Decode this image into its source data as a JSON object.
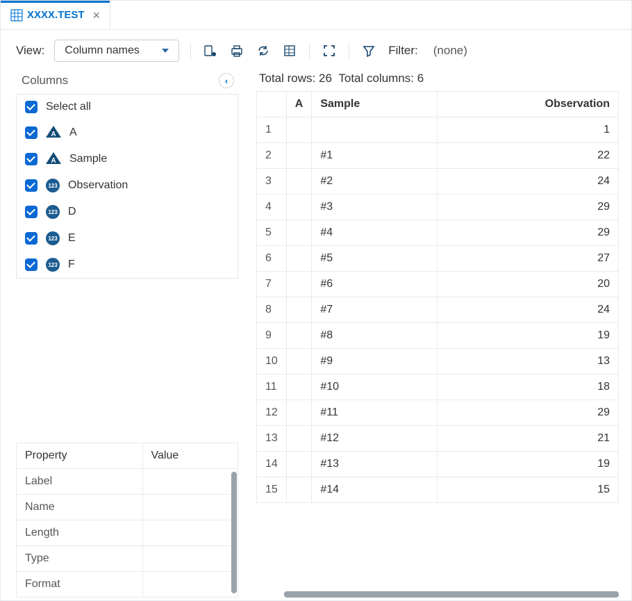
{
  "tab": {
    "title": "XXXX.TEST"
  },
  "toolbar": {
    "view_label": "View:",
    "view_value": "Column names",
    "filter_label": "Filter:",
    "filter_value": "(none)"
  },
  "columns": {
    "panel_title": "Columns",
    "select_all_label": "Select all",
    "items": [
      {
        "name": "A",
        "type": "char"
      },
      {
        "name": "Sample",
        "type": "char"
      },
      {
        "name": "Observation",
        "type": "num"
      },
      {
        "name": "D",
        "type": "num"
      },
      {
        "name": "E",
        "type": "num"
      },
      {
        "name": "F",
        "type": "num"
      }
    ]
  },
  "properties": {
    "header_property": "Property",
    "header_value": "Value",
    "rows": [
      {
        "prop": "Label",
        "val": ""
      },
      {
        "prop": "Name",
        "val": ""
      },
      {
        "prop": "Length",
        "val": ""
      },
      {
        "prop": "Type",
        "val": ""
      },
      {
        "prop": "Format",
        "val": ""
      }
    ]
  },
  "data": {
    "stats": {
      "rows_label": "Total rows:",
      "rows": 26,
      "cols_label": "Total columns:",
      "cols": 6
    },
    "headers": {
      "a": "A",
      "sample": "Sample",
      "obs": "Observation"
    },
    "rows": [
      {
        "n": 1,
        "a": "",
        "sample": "",
        "obs": 1
      },
      {
        "n": 2,
        "a": "",
        "sample": "#1",
        "obs": 22
      },
      {
        "n": 3,
        "a": "",
        "sample": "#2",
        "obs": 24
      },
      {
        "n": 4,
        "a": "",
        "sample": "#3",
        "obs": 29
      },
      {
        "n": 5,
        "a": "",
        "sample": "#4",
        "obs": 29
      },
      {
        "n": 6,
        "a": "",
        "sample": "#5",
        "obs": 27
      },
      {
        "n": 7,
        "a": "",
        "sample": "#6",
        "obs": 20
      },
      {
        "n": 8,
        "a": "",
        "sample": "#7",
        "obs": 24
      },
      {
        "n": 9,
        "a": "",
        "sample": "#8",
        "obs": 19
      },
      {
        "n": 10,
        "a": "",
        "sample": "#9",
        "obs": 13
      },
      {
        "n": 11,
        "a": "",
        "sample": "#10",
        "obs": 18
      },
      {
        "n": 12,
        "a": "",
        "sample": "#11",
        "obs": 29
      },
      {
        "n": 13,
        "a": "",
        "sample": "#12",
        "obs": 21
      },
      {
        "n": 14,
        "a": "",
        "sample": "#13",
        "obs": 19
      },
      {
        "n": 15,
        "a": "",
        "sample": "#14",
        "obs": 15
      }
    ]
  },
  "type_labels": {
    "char": "A",
    "num": "123"
  }
}
